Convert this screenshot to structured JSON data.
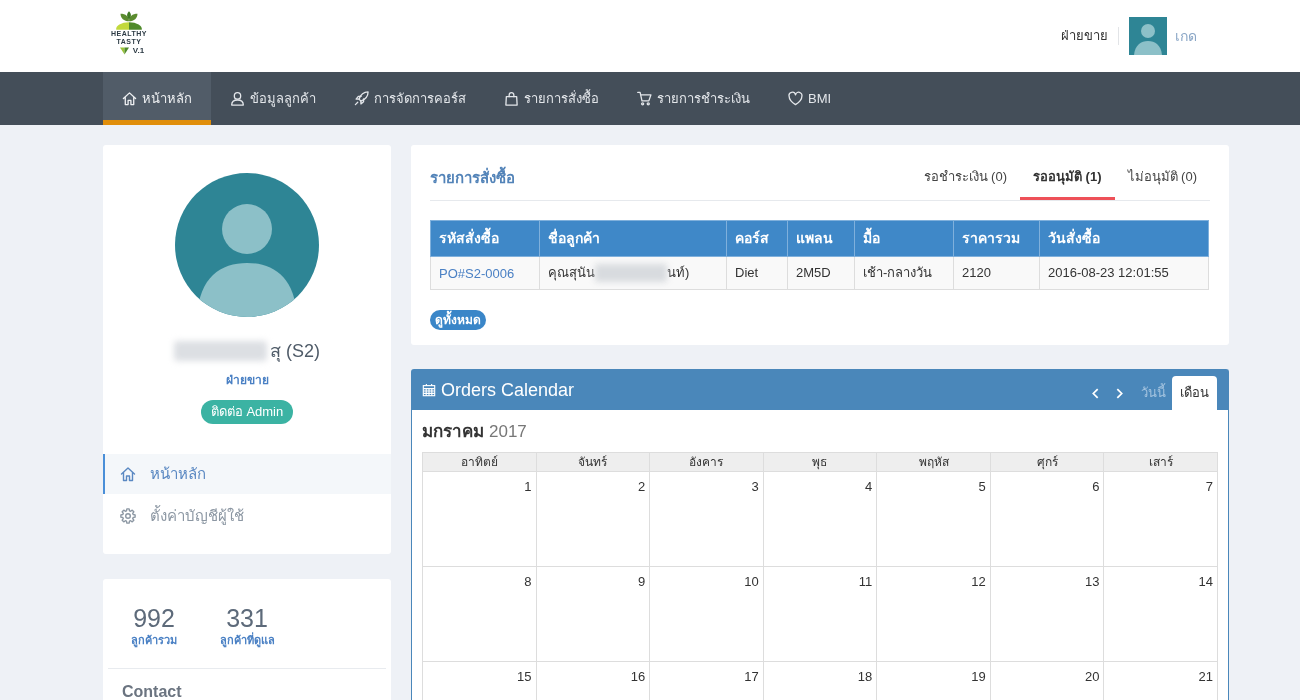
{
  "header": {
    "logo": {
      "lines": [
        "HEALTHY",
        "TASTY"
      ],
      "version": "V.1"
    },
    "user": {
      "role": "ฝ่ายขาย",
      "name": "เกด"
    }
  },
  "nav": [
    {
      "label": "หน้าหลัก",
      "selected": true
    },
    {
      "label": "ข้อมูลลูกค้า",
      "selected": false
    },
    {
      "label": "การจัดการคอร์ส",
      "selected": false
    },
    {
      "label": "รายการสั่งซื้อ",
      "selected": false
    },
    {
      "label": "รายการชำระเงิน",
      "selected": false
    },
    {
      "label": "BMI",
      "selected": false
    }
  ],
  "profile": {
    "name": "สุ (S2)",
    "role": "ฝ่ายขาย",
    "contact_button": "ติดต่อ Admin",
    "menu": [
      {
        "label": "หน้าหลัก",
        "selected": true
      },
      {
        "label": "ตั้งค่าบัญชีผู้ใช้",
        "selected": false
      }
    ]
  },
  "stats": {
    "items": [
      {
        "value": "992",
        "label": "ลูกค้ารวม"
      },
      {
        "value": "331",
        "label": "ลูกค้าที่ดูแล"
      }
    ],
    "contact_heading": "Contact"
  },
  "orders": {
    "title": "รายการสั่งซื้อ",
    "tabs": [
      {
        "label": "รอชำระเงิน (0)",
        "selected": false
      },
      {
        "label": "รออนุมัติ (1)",
        "selected": true
      },
      {
        "label": "ไม่อนุมัติ (0)",
        "selected": false
      }
    ],
    "table": {
      "columns": [
        "รหัสสั่งซื้อ",
        "ชื่อลูกค้า",
        "คอร์ส",
        "แพลน",
        "มื้อ",
        "ราคารวม",
        "วันสั่งซื้อ"
      ],
      "rows": [
        {
          "order_id": "PO#S2-0006",
          "customer_name_start": "คุณสุนัน",
          "customer_name_end": "นท์)",
          "course": "Diet",
          "plan": "2M5D",
          "meals": "เช้า-กลางวัน",
          "total": "2120",
          "order_date": "2016-08-23 12:01:55"
        }
      ]
    },
    "view_all_button": "ดูทั้งหมด"
  },
  "calendar": {
    "title": "Orders Calendar",
    "today_button": {
      "label": "วันนี้",
      "disabled": true
    },
    "view_tabs": [
      {
        "label": "เดือน",
        "selected": true
      }
    ],
    "month": "มกราคม",
    "year": "2017",
    "weekdays": [
      "อาทิตย์",
      "จันทร์",
      "อังคาร",
      "พุธ",
      "พฤหัส",
      "ศุกร์",
      "เสาร์"
    ],
    "weeks": [
      [
        "1",
        "2",
        "3",
        "4",
        "5",
        "6",
        "7"
      ],
      [
        "8",
        "9",
        "10",
        "11",
        "12",
        "13",
        "14"
      ],
      [
        "15",
        "16",
        "17",
        "18",
        "19",
        "20",
        "21"
      ]
    ]
  }
}
